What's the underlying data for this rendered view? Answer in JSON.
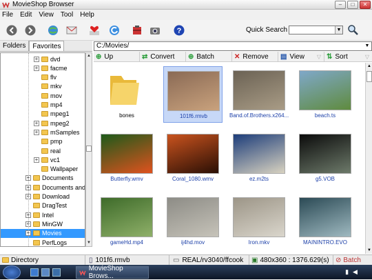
{
  "window": {
    "title": "MovieShop Browser",
    "minimize": "–",
    "maximize": "□",
    "close": "✕"
  },
  "menu": [
    "File",
    "Edit",
    "View",
    "Tool",
    "Help"
  ],
  "toolbar": {
    "quick_search_label": "Quick Search",
    "quick_search_value": ""
  },
  "sidebar": {
    "tabs": [
      "Folders",
      "Favorites"
    ],
    "items": [
      {
        "label": "dvd",
        "expander": "+",
        "indent": 1
      },
      {
        "label": "facme",
        "expander": "+",
        "indent": 1
      },
      {
        "label": "flv",
        "expander": "",
        "indent": 1
      },
      {
        "label": "mkv",
        "expander": "",
        "indent": 1
      },
      {
        "label": "mov",
        "expander": "",
        "indent": 1
      },
      {
        "label": "mp4",
        "expander": "",
        "indent": 1
      },
      {
        "label": "mpeg1",
        "expander": "",
        "indent": 1
      },
      {
        "label": "mpeg2",
        "expander": "+",
        "indent": 1
      },
      {
        "label": "mSamples",
        "expander": "+",
        "indent": 1
      },
      {
        "label": "pmp",
        "expander": "",
        "indent": 1
      },
      {
        "label": "real",
        "expander": "",
        "indent": 1
      },
      {
        "label": "vc1",
        "expander": "+",
        "indent": 1
      },
      {
        "label": "Wallpaper",
        "expander": "",
        "indent": 1
      },
      {
        "label": "Documents",
        "expander": "+",
        "indent": 0
      },
      {
        "label": "Documents and",
        "expander": "+",
        "indent": 0
      },
      {
        "label": "Download",
        "expander": "+",
        "indent": 0
      },
      {
        "label": "DragTest",
        "expander": "",
        "indent": 0
      },
      {
        "label": "Intel",
        "expander": "+",
        "indent": 0
      },
      {
        "label": "MinGW",
        "expander": "+",
        "indent": 0
      },
      {
        "label": "Movies",
        "expander": "+",
        "indent": 0,
        "selected": true
      },
      {
        "label": "PerfLogs",
        "expander": "",
        "indent": 0
      }
    ]
  },
  "path": {
    "value": "C:/Movies/"
  },
  "actions": [
    {
      "label": "Up",
      "icon": "up-arrow-icon",
      "color": "#2a9d3a"
    },
    {
      "label": "Convert",
      "icon": "convert-icon",
      "color": "#2a9d3a"
    },
    {
      "label": "Batch",
      "icon": "batch-icon",
      "color": "#2a9d3a"
    },
    {
      "label": "Remove",
      "icon": "remove-icon",
      "color": "#cc2222"
    },
    {
      "label": "View",
      "icon": "view-icon",
      "color": "#2255aa"
    },
    {
      "label": "Sort",
      "icon": "sort-icon",
      "color": "#2a9d3a"
    }
  ],
  "files": [
    {
      "name": "bones",
      "kind": "folder"
    },
    {
      "name": "101f6.rmvb",
      "kind": "video",
      "selected": true,
      "thumb": [
        "#8a6a55",
        "#c9a27d"
      ]
    },
    {
      "name": "Band.of.Brothers.x264...",
      "kind": "video",
      "thumb": [
        "#6b6254",
        "#a99c86"
      ]
    },
    {
      "name": "beach.ts",
      "kind": "video",
      "thumb": [
        "#7fa8c9",
        "#5f8b3e"
      ]
    },
    {
      "name": "Butterfly.wmv",
      "kind": "video",
      "thumb": [
        "#1d5a1a",
        "#e0521e"
      ]
    },
    {
      "name": "Coral_1080.wmv",
      "kind": "video",
      "thumb": [
        "#c9531e",
        "#2a0f05"
      ]
    },
    {
      "name": "ez.m2ts",
      "kind": "video",
      "thumb": [
        "#1d3d7a",
        "#d8d2c0"
      ]
    },
    {
      "name": "g5.VOB",
      "kind": "video",
      "thumb": [
        "#0b0b0b",
        "#6d7a6a"
      ]
    },
    {
      "name": "gameHd.mp4",
      "kind": "video",
      "thumb": [
        "#3e6b2a",
        "#8fb069"
      ]
    },
    {
      "name": "ij4hd.mov",
      "kind": "video",
      "thumb": [
        "#8d8c86",
        "#c6c3b9"
      ]
    },
    {
      "name": "Iron.mkv",
      "kind": "video",
      "thumb": [
        "#9c9587",
        "#dad6cc"
      ]
    },
    {
      "name": "MAININTRO.EVO",
      "kind": "video",
      "thumb": [
        "#2b4a55",
        "#9fb9c0"
      ]
    }
  ],
  "status": {
    "type": "Directory",
    "file": "101f6.rmvb",
    "codec": "REAL/rv3040/ffcook",
    "dims": "480x360 : 1376.629(s)",
    "batch": "Batch"
  },
  "taskbar": {
    "task": "MovieShop Brows..."
  }
}
